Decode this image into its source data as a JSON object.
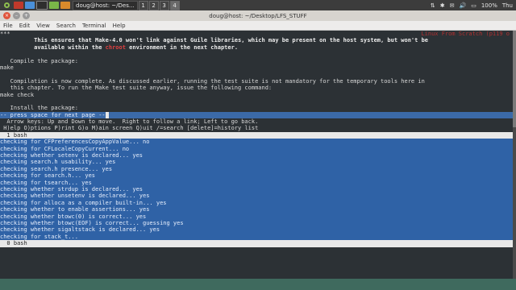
{
  "panel": {
    "task_label": "doug@host: ~/Des...",
    "workspaces": [
      "1",
      "2",
      "3",
      "4"
    ],
    "battery": "100%",
    "clock": "Thu"
  },
  "window": {
    "title": "doug@host: ~/Desktop/LFS_STUFF",
    "menu": [
      "File",
      "Edit",
      "View",
      "Search",
      "Terminal",
      "Help"
    ]
  },
  "terminal": {
    "header_note": "Linux From Scratch (p119 o",
    "top_prefix": "***",
    "lines": [
      {
        "text": "          This ensures that Make-4.0 won't link against Guile libraries, which may be present on the host system, but won't be",
        "style": "bold"
      },
      {
        "text": "          available within the chroot environment in the next chapter.",
        "style": "bold"
      },
      {
        "text": "",
        "style": ""
      },
      {
        "text": "   Compile the package:",
        "style": ""
      },
      {
        "text": "make",
        "style": ""
      },
      {
        "text": "",
        "style": ""
      },
      {
        "text": "   Compilation is now complete. As discussed earlier, running the test suite is not mandatory for the temporary tools here in",
        "style": ""
      },
      {
        "text": "   this chapter. To run the Make test suite anyway, issue the following command:",
        "style": ""
      },
      {
        "text": "make check",
        "style": ""
      },
      {
        "text": "",
        "style": ""
      },
      {
        "text": "   Install the package:",
        "style": ""
      }
    ],
    "chroot_word": "chroot",
    "status": "-- press space for next page --",
    "help_lines": [
      "  Arrow keys: Up and Down to move.  Right to follow a link; Left to go back.",
      " H)elp O)ptions P)rint G)o M)ain screen Q)uit /=search [delete]=history list"
    ],
    "pane_top": "  1 bash",
    "build_lines": [
      "checking for CFPreferencesCopyAppValue... no",
      "checking for CFLocaleCopyCurrent... no",
      "checking whether setenv is declared... yes",
      "checking search.h usability... yes",
      "checking search.h presence... yes",
      "checking for search.h... yes",
      "checking for tsearch... yes",
      "checking whether strdup is declared... yes",
      "checking whether unsetenv is declared... yes",
      "checking for alloca as a compiler built-in... yes",
      "checking whether to enable assertions... yes",
      "checking whether btowc(0) is correct... yes",
      "checking whether btowc(EOF) is correct... guessing yes",
      "checking whether sigaltstack is declared... yes",
      "checking for stack_t..."
    ],
    "pane_bottom": "  0 bash"
  }
}
